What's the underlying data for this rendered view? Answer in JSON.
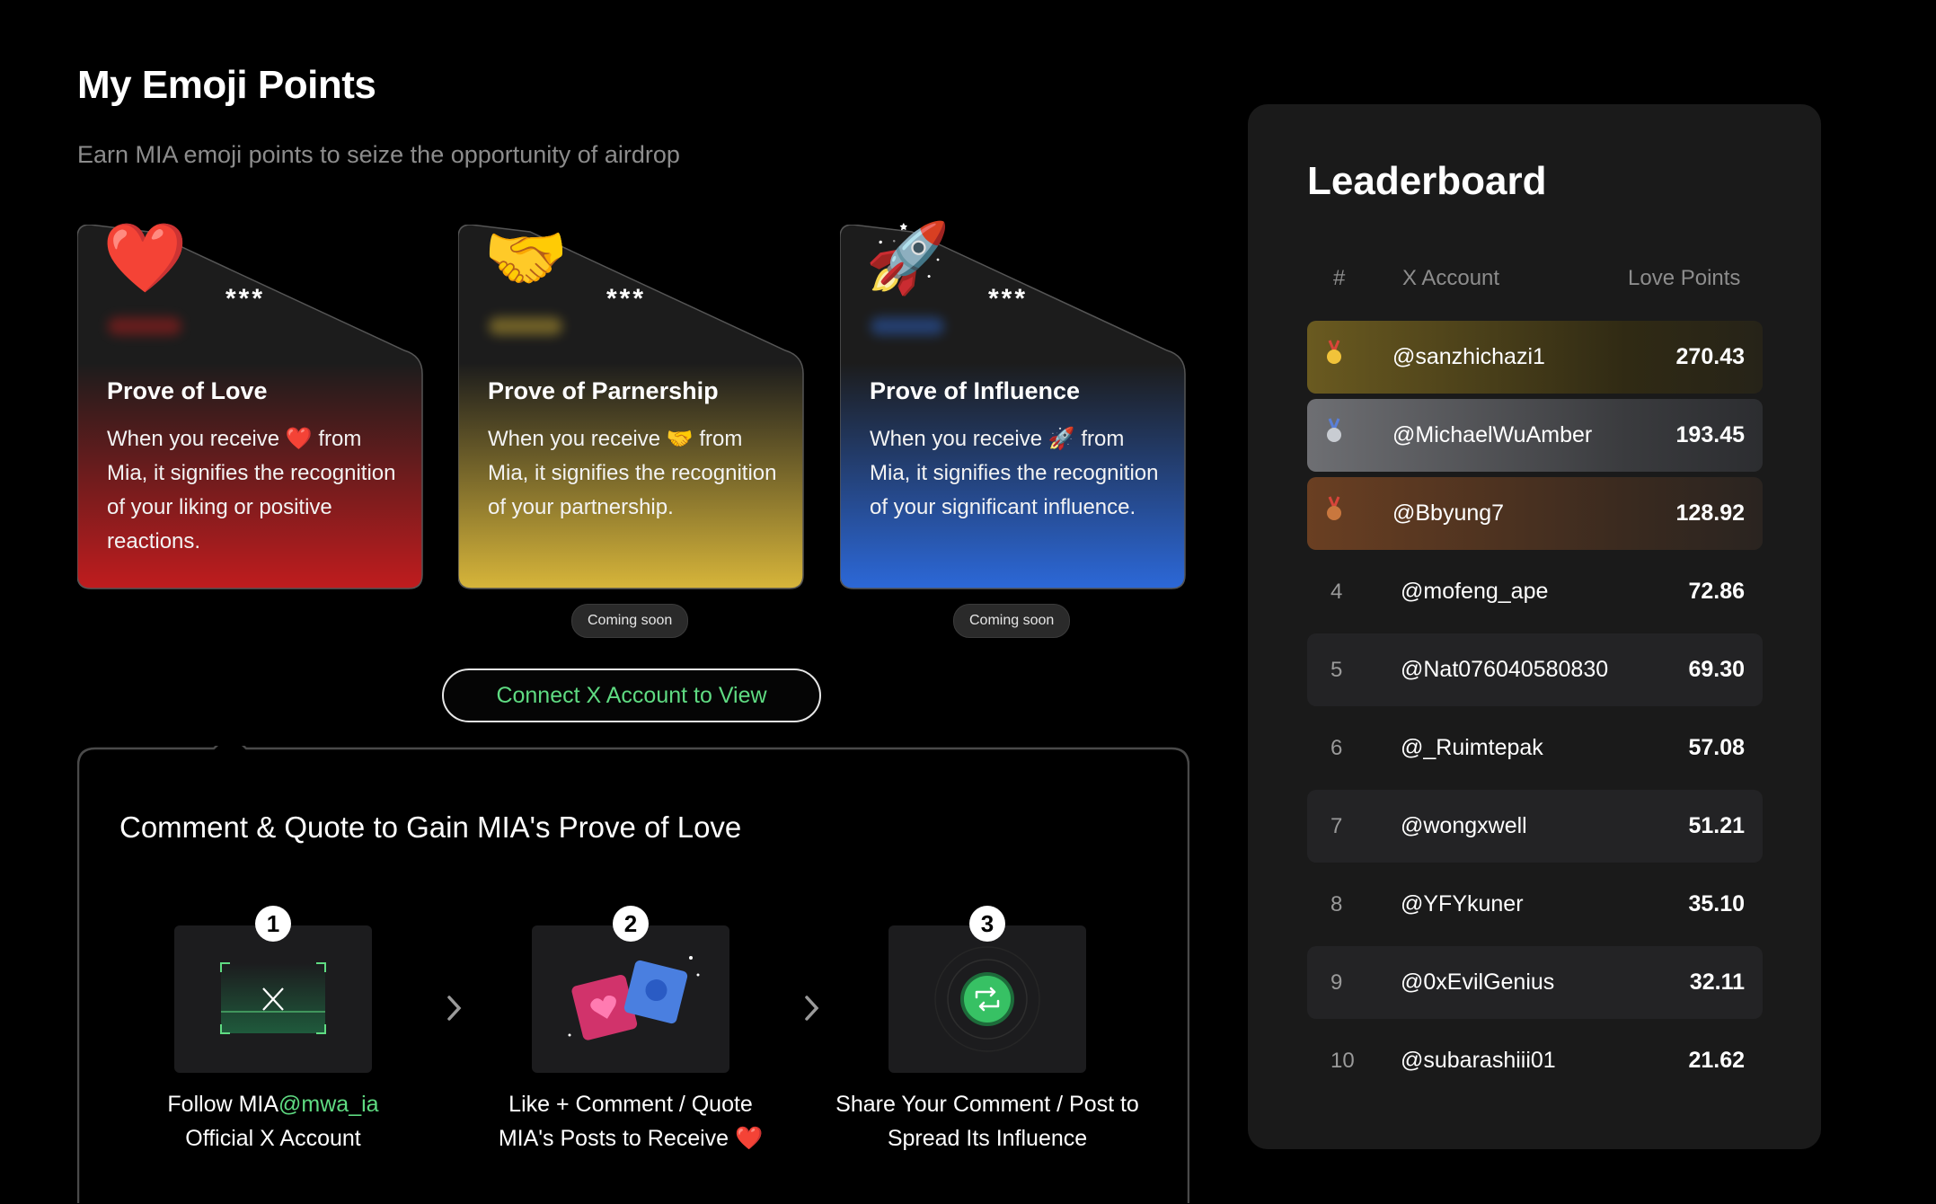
{
  "header": {
    "title": "My Emoji Points",
    "subtitle": "Earn MIA emoji points to seize the opportunity of airdrop"
  },
  "cards": [
    {
      "emoji": "❤️",
      "stars": "***",
      "title": "Prove of Love",
      "desc": "When you receive ❤️ from Mia, it signifies the recognition of your liking or positive reactions.",
      "color": "#c2201f"
    },
    {
      "emoji": "🤝",
      "stars": "***",
      "title": "Prove of Parnership",
      "desc": "When you receive 🤝 from Mia, it signifies the recognition of your partnership.",
      "color": "#d6b436",
      "badge": "Coming soon"
    },
    {
      "emoji": "🚀",
      "stars": "***",
      "title": "Prove of Influence",
      "desc": "When you receive 🚀 from Mia, it signifies the recognition of your significant influence.",
      "color": "#2f6ad6",
      "badge": "Coming soon"
    }
  ],
  "connect_button": "Connect X Account to View",
  "task": {
    "title": "Comment & Quote to Gain MIA's Prove of Love",
    "steps": [
      {
        "num": "1",
        "label_pre": "Follow MIA",
        "label_handle": "@mwa_ia",
        "label_post": "Official X Account",
        "icon": "x-logo-icon"
      },
      {
        "num": "2",
        "label": "Like + Comment / Quote MIA's Posts to Receive ❤️",
        "icon": "like-comment-icon"
      },
      {
        "num": "3",
        "label": "Share Your Comment / Post to Spread Its Influence",
        "icon": "share-retweet-icon"
      }
    ]
  },
  "leaderboard": {
    "title": "Leaderboard",
    "columns": {
      "rank": "#",
      "account": "X Account",
      "points": "Love Points"
    },
    "rows": [
      {
        "rank": "1",
        "account": "@sanzhichazi1",
        "points": "270.43",
        "medal": "gold"
      },
      {
        "rank": "2",
        "account": "@MichaelWuAmber",
        "points": "193.45",
        "medal": "silver"
      },
      {
        "rank": "3",
        "account": "@Bbyung7",
        "points": "128.92",
        "medal": "bronze"
      },
      {
        "rank": "4",
        "account": "@mofeng_ape",
        "points": "72.86"
      },
      {
        "rank": "5",
        "account": "@Nat076040580830",
        "points": "69.30"
      },
      {
        "rank": "6",
        "account": "@_Ruimtepak",
        "points": "57.08"
      },
      {
        "rank": "7",
        "account": "@wongxwell",
        "points": "51.21"
      },
      {
        "rank": "8",
        "account": "@YFYkuner",
        "points": "35.10"
      },
      {
        "rank": "9",
        "account": "@0xEvilGenius",
        "points": "32.11"
      },
      {
        "rank": "10",
        "account": "@subarashiii01",
        "points": "21.62"
      }
    ]
  },
  "colors": {
    "accent_green": "#5fdb82",
    "panel": "#1a1a1a"
  }
}
